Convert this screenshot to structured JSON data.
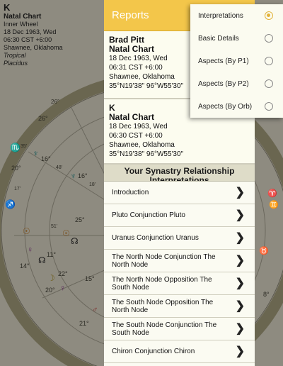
{
  "chart_info": {
    "initial": "K",
    "chart_type": "Natal Chart",
    "wheel": "Inner Wheel",
    "date": "18 Dec 1963, Wed",
    "time": "06:30 CST +6:00",
    "place": "Shawnee, Oklahoma",
    "zodiac": "Tropical",
    "houses": "Placidus"
  },
  "wheel_labels": {
    "deg_26": "26°",
    "deg_26b": "26°",
    "deg_35": "35'",
    "deg_20": "20°",
    "deg_16": "16°",
    "deg_48": "48'",
    "deg_16b": "16°",
    "deg_18": "18'",
    "deg_17": "17'",
    "deg_25": "25°",
    "deg_51": "51'",
    "deg_11": "11°",
    "deg_14": "14°",
    "deg_22": "22°",
    "deg_20b": "20°",
    "deg_21": "21°",
    "deg_15": "15°",
    "deg_8": "8°"
  },
  "report": {
    "header": "Reports",
    "person1": {
      "name": "Brad Pitt",
      "chart": "Natal Chart",
      "date": "18 Dec 1963, Wed",
      "time": "06:31  CST +6:00",
      "place": "Shawnee, Oklahoma",
      "coords": "35°N19'38\"  96°W55'30\""
    },
    "person2": {
      "name": "K",
      "chart": "Natal Chart",
      "date": "18 Dec 1963, Wed",
      "time": "06:30  CST +6:00",
      "place": "Shawnee, Oklahoma",
      "coords": "35°N19'38\"  96°W55'30\""
    },
    "synastry_title": "Your Synastry Relationship Interpretations",
    "items": [
      "Introduction",
      "Pluto Conjunction Pluto",
      "Uranus Conjunction Uranus",
      "The North Node Conjunction The North Node",
      "The North Node Opposition The South Node",
      "The South Node Opposition The North Node",
      "The South Node Conjunction The South Node",
      "Chiron Conjunction Chiron"
    ],
    "chevron": "❯"
  },
  "menu": {
    "items": [
      {
        "label": "Interpretations",
        "selected": true
      },
      {
        "label": "Basic Details",
        "selected": false
      },
      {
        "label": "Aspects (By P1)",
        "selected": false
      },
      {
        "label": "Aspects (By P2)",
        "selected": false
      },
      {
        "label": "Aspects (By Orb)",
        "selected": false
      }
    ]
  },
  "colors": {
    "header": "#f3c64a",
    "radio_selected": "#e2b33a",
    "dim_background": "#8e8b80"
  }
}
